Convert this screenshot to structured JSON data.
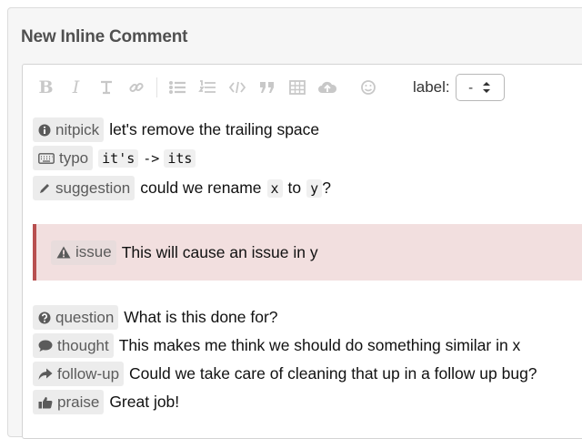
{
  "heading": "New Inline Comment",
  "toolbar": {
    "icons": [
      "bold-icon",
      "italic-icon",
      "heading-icon",
      "link-icon",
      "bullet-list-icon",
      "numbered-list-icon",
      "code-icon",
      "quote-icon",
      "table-icon",
      "upload-icon",
      "emoji-icon"
    ],
    "bold": "B",
    "italic": "I",
    "label_text": "label:",
    "label_select_value": "-"
  },
  "comments": [
    {
      "label": "nitpick",
      "icon": "info-circle-icon",
      "text": "let's remove the trailing space"
    },
    {
      "label": "typo",
      "icon": "keyboard-icon",
      "code_a": "it's",
      "arrow": "->",
      "code_b": "its"
    },
    {
      "label": "suggestion",
      "icon": "pencil-icon",
      "text_a": "could we rename",
      "code_a": "x",
      "text_b": "to",
      "code_b": "y",
      "text_c": "?"
    }
  ],
  "issue": {
    "label": "issue",
    "icon": "warning-icon",
    "text": "This will cause an issue in y"
  },
  "comments2": [
    {
      "label": "question",
      "icon": "question-circle-icon",
      "text": "What is this done for?"
    },
    {
      "label": "thought",
      "icon": "speech-bubble-icon",
      "text": "This makes me think we should do something similar in x"
    },
    {
      "label": "follow-up",
      "icon": "share-arrow-icon",
      "text": "Could we take care of cleaning that up in a follow up bug?"
    },
    {
      "label": "praise",
      "icon": "thumbs-up-icon",
      "text": "Great job!"
    }
  ],
  "colors": {
    "callout_bg": "#f2dfdf",
    "callout_border": "#b85050",
    "badge_bg": "#ececec"
  }
}
